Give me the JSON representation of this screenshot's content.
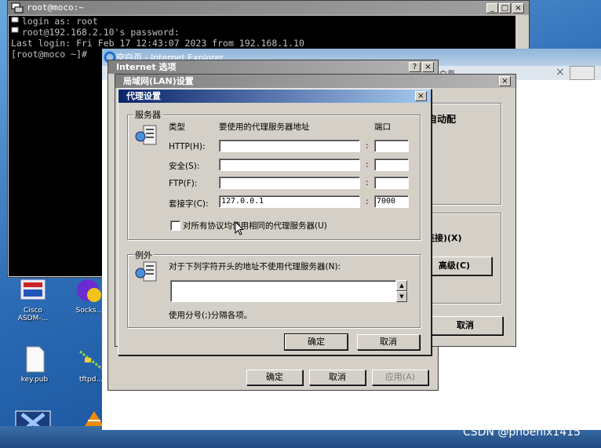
{
  "terminal": {
    "title": "root@moco:~",
    "lines": [
      "  login as: root",
      "  root@192.168.2.10's password:",
      "Last login: Fri Feb 17 12:43:07 2023 from 192.168.1.10",
      "[root@moco ~]# "
    ]
  },
  "ie": {
    "title": "空白页 - Internet Explorer",
    "tab": "空白页"
  },
  "internet_options": {
    "title": "Internet 选项",
    "ok": "确定",
    "cancel": "取消",
    "apply": "应用(A)"
  },
  "lan_settings": {
    "title": "局域网(LAN)设置",
    "auto_config_fragment": "自动配",
    "connection_fragment": "连接)(X)",
    "advanced": "高级(C)",
    "cancel": "取消"
  },
  "proxy": {
    "title": "代理设置",
    "servers_group": "服务器",
    "col_type": "类型",
    "col_address": "要使用的代理服务器地址",
    "col_port": "端口",
    "rows": [
      {
        "label": "HTTP(H):",
        "address": "",
        "port": ""
      },
      {
        "label": "安全(S):",
        "address": "",
        "port": ""
      },
      {
        "label": "FTP(F):",
        "address": "",
        "port": ""
      },
      {
        "label": "套接字(C):",
        "address": "127.0.0.1",
        "port": "7000"
      }
    ],
    "same_proxy_label": "对所有协议均使用相同的代理服务器(U)",
    "same_proxy_checked": false,
    "exceptions_group": "例外",
    "exceptions_text": "对于下列字符开头的地址不使用代理服务器(N):",
    "exceptions_value": "",
    "exceptions_hint": "使用分号(;)分隔各项。",
    "ok": "确定",
    "cancel": "取消"
  },
  "desktop_icons": [
    {
      "label": "Cisco ASDM-..."
    },
    {
      "label": "Socks..."
    },
    {
      "label": "key.pub"
    },
    {
      "label": "tftpd..."
    }
  ],
  "watermark": "CSDN @phoenix1415",
  "colors": {
    "title_active": "#0a246a",
    "dialog_bg": "#d4d0c8",
    "desktop": "#2c6cb5"
  }
}
